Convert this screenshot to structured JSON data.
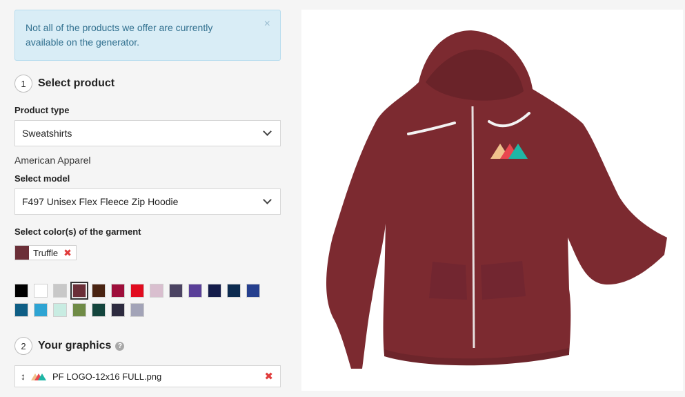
{
  "alert": {
    "message": "Not all of the products we offer are currently available on the generator.",
    "close": "×"
  },
  "step1": {
    "number": "1",
    "title": "Select product"
  },
  "product_type": {
    "label": "Product type",
    "value": "Sweatshirts"
  },
  "brand": "American Apparel",
  "model": {
    "label": "Select model",
    "value": "F497 Unisex Flex Fleece Zip Hoodie"
  },
  "colors": {
    "label": "Select color(s) of the garment",
    "selected": {
      "name": "Truffle",
      "hex": "#6b2f38"
    },
    "remove": "✖",
    "row1": [
      "#000000",
      "#ffffff",
      "#c8c8c8",
      "#6b2f38",
      "#4a2412",
      "#9e0f3b",
      "#e10c1f",
      "#d9bfcf",
      "#4b4362",
      "#5a3f98",
      "#141c4a",
      "#0d2b50",
      "#253f8e"
    ],
    "row2": [
      "#0e5e85",
      "#2ea4d3",
      "#c8ece2",
      "#6f8b46",
      "#14453d",
      "#2d2b3f",
      "#a2a3b7"
    ]
  },
  "step2": {
    "number": "2",
    "title": "Your graphics",
    "help": "?"
  },
  "graphic": {
    "handle": "↕",
    "filename": "PF LOGO-12x16 FULL.png",
    "remove": "✖"
  },
  "preview": {
    "garment_color": "#7c2a30",
    "logo_colors": [
      "#f0c28d",
      "#e8474f",
      "#1fb6a6"
    ]
  }
}
